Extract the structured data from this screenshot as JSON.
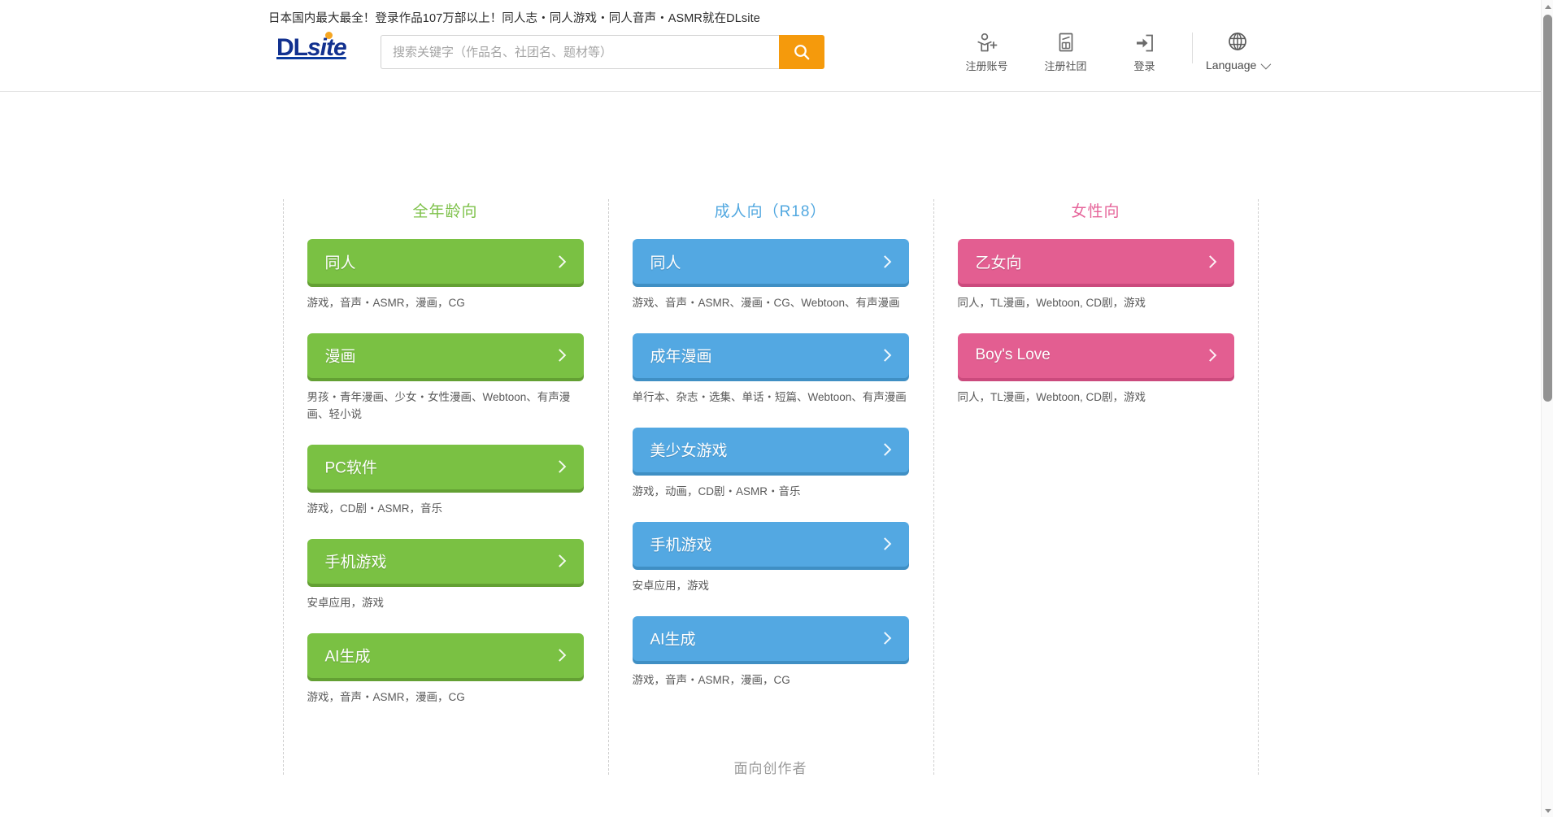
{
  "header": {
    "tagline": "日本国内最大最全！登录作品107万部以上！同人志・同人游戏・同人音声・ASMR就在DLsite",
    "logo_dl": "DL",
    "logo_site": "site",
    "search": {
      "placeholder": "搜索关键字（作品名、社团名、题材等）",
      "value": "",
      "button_icon": "search-icon"
    },
    "nav": [
      {
        "icon": "user-plus-icon",
        "label": "注册账号"
      },
      {
        "icon": "building-register-icon",
        "label": "注册社团"
      },
      {
        "icon": "login-arrow-icon",
        "label": "登录"
      }
    ],
    "language": {
      "icon": "globe-icon",
      "label": "Language"
    }
  },
  "columns": [
    {
      "key": "all-ages",
      "title": "全年龄向",
      "color": "#7ac143",
      "accent": "green",
      "items": [
        {
          "label": "同人",
          "desc": "游戏，音声・ASMR，漫画，CG"
        },
        {
          "label": "漫画",
          "desc": "男孩・青年漫画、少女・女性漫画、Webtoon、有声漫画、轻小说"
        },
        {
          "label": "PC软件",
          "desc": "游戏，CD剧・ASMR，音乐"
        },
        {
          "label": "手机游戏",
          "desc": "安卓应用，游戏"
        },
        {
          "label": "AI生成",
          "desc": "游戏，音声・ASMR，漫画，CG"
        }
      ]
    },
    {
      "key": "adult-r18",
      "title": "成人向（R18）",
      "color": "#53a8e2",
      "accent": "blue",
      "items": [
        {
          "label": "同人",
          "desc": "游戏、音声・ASMR、漫画・CG、Webtoon、有声漫画"
        },
        {
          "label": "成年漫画",
          "desc": "单行本、杂志・选集、单话・短篇、Webtoon、有声漫画"
        },
        {
          "label": "美少女游戏",
          "desc": "游戏，动画，CD剧・ASMR・音乐"
        },
        {
          "label": "手机游戏",
          "desc": "安卓应用，游戏"
        },
        {
          "label": "AI生成",
          "desc": "游戏，音声・ASMR，漫画，CG"
        }
      ]
    },
    {
      "key": "for-women",
      "title": "女性向",
      "color": "#e35e91",
      "accent": "pink",
      "items": [
        {
          "label": "乙女向",
          "desc": "同人，TL漫画，Webtoon, CD剧，游戏"
        },
        {
          "label": "Boy's Love",
          "desc": "同人，TL漫画，Webtoon, CD剧，游戏"
        }
      ]
    }
  ],
  "creator": {
    "title": "面向创作者"
  },
  "scrollbar": {
    "position": "top",
    "thumb_pct": "47"
  }
}
